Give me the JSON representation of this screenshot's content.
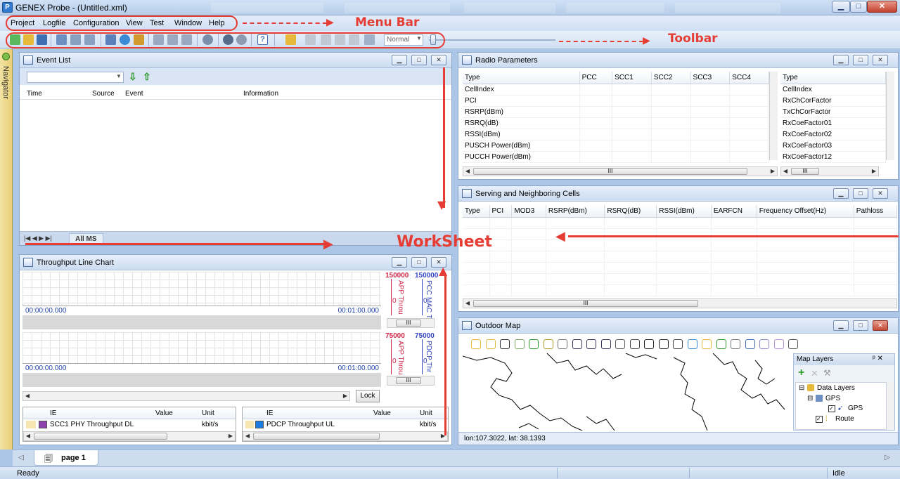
{
  "window": {
    "title": "GENEX Probe - (Untitled.xml)",
    "app_icon": "app-icon",
    "minimize": "▁",
    "maximize": "□",
    "close": "✕"
  },
  "menu": {
    "items": [
      "Project",
      "Logfile",
      "Configuration",
      "View",
      "Test",
      "Window",
      "Help"
    ]
  },
  "toolbar": {
    "mode_value": "Normal"
  },
  "annotations": {
    "menu_bar": "Menu Bar",
    "toolbar": "Toolbar",
    "worksheet": "WorkSheet",
    "color": "#e53c33"
  },
  "navigator": {
    "label": "Navigator"
  },
  "event_list": {
    "title": "Event List",
    "columns": [
      "Time",
      "Source",
      "Event",
      "Information"
    ],
    "tab_label": "All MS"
  },
  "radio_params": {
    "title": "Radio Parameters",
    "columns": [
      "Type",
      "PCC",
      "SCC1",
      "SCC2",
      "SCC3",
      "SCC4"
    ],
    "rows": [
      "CellIndex",
      "PCI",
      "RSRP(dBm)",
      "RSRQ(dB)",
      "RSSI(dBm)",
      "PUSCH Power(dBm)",
      "PUCCH Power(dBm)"
    ],
    "right_header": "Type",
    "right_rows": [
      "CellIndex",
      "RxChCorFactor",
      "TxChCorFactor",
      "RxCoeFactor01",
      "RxCoeFactor02",
      "RxCoeFactor03",
      "RxCoeFactor12"
    ],
    "scroll_thumb": "III"
  },
  "serving_cells": {
    "title": "Serving and Neighboring Cells",
    "columns": [
      "Type",
      "PCI",
      "MOD3",
      "RSRP(dBm)",
      "RSRQ(dB)",
      "RSSI(dBm)",
      "EARFCN",
      "Frequency Offset(Hz)",
      "Pathloss"
    ],
    "scroll_thumb": "III"
  },
  "throughput": {
    "title": "Throughput Line Chart",
    "chart1": {
      "start_time": "00:00:00.000",
      "end_time": "00:01:00.000",
      "axis_max_1": "150000",
      "axis_max_2": "150000",
      "axis_min": "0",
      "axis_label_1": "APP Throu",
      "axis_label_2": "PCC MAC T"
    },
    "chart2": {
      "start_time": "00:00:00.000",
      "end_time": "00:01:00.000",
      "axis_max_1": "75000",
      "axis_max_2": "75000",
      "axis_min": "0",
      "axis_label_1": "APP Throu",
      "axis_label_2": "PDCP Thr"
    },
    "lock_label": "Lock",
    "scroll_thumb": "III",
    "legend_left": {
      "columns": [
        "IE",
        "Value",
        "Unit"
      ],
      "row": {
        "ie": "SCC1 PHY Throughput DL",
        "value": "",
        "unit": "kbit/s",
        "color": "#8e3fb0"
      }
    },
    "legend_right": {
      "columns": [
        "IE",
        "Value",
        "Unit"
      ],
      "row": {
        "ie": "PDCP Throughput UL",
        "value": "",
        "unit": "kbit/s",
        "color": "#1e7be0"
      }
    }
  },
  "outdoor_map": {
    "title": "Outdoor Map",
    "coords": "lon:107.3022, lat: 38.1393",
    "layers_title": "Map Layers",
    "layers": {
      "root": "Data Layers",
      "group": "GPS",
      "item": "GPS",
      "route": "Route"
    },
    "pin": "ᵖ ✕"
  },
  "tabs": {
    "page": "page 1"
  },
  "status": {
    "left": "Ready",
    "right": "Idle"
  }
}
